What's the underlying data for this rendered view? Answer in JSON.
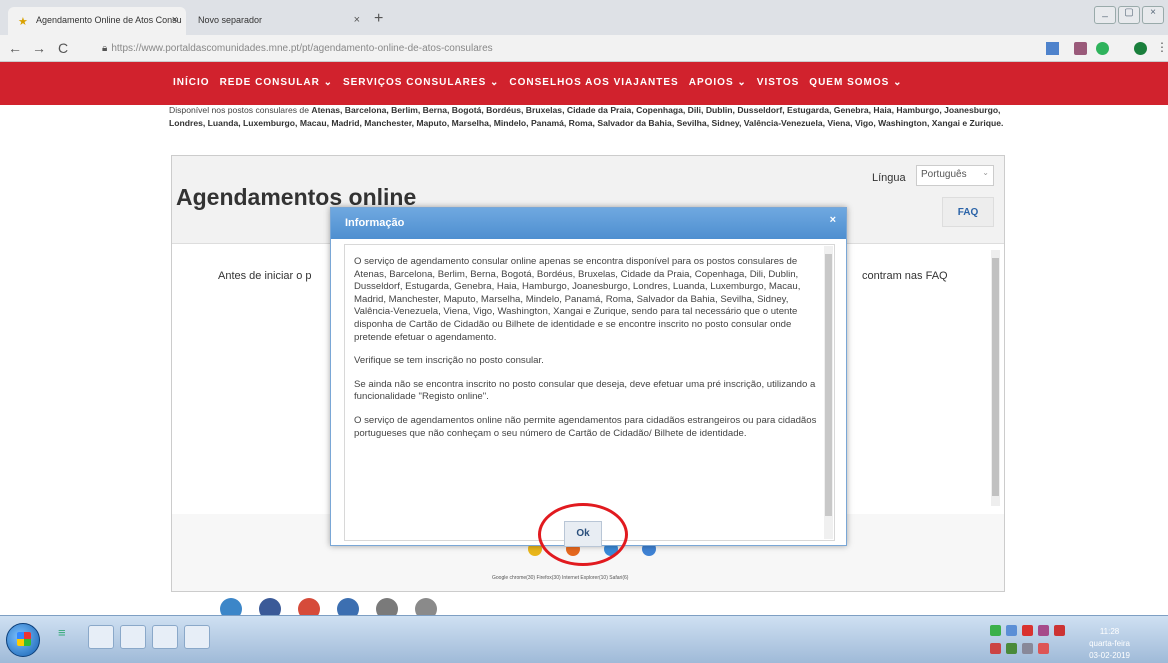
{
  "browser": {
    "tabs": [
      {
        "label": "Agendamento Online de Atos Consu",
        "close": "×"
      },
      {
        "label": "Novo separador",
        "close": "×"
      }
    ],
    "new_tab": "+",
    "nav": {
      "back": "←",
      "forward": "→",
      "reload": "C"
    },
    "url": "https://www.portaldascomunidades.mne.pt/pt/agendamento-online-de-atos-consulares",
    "window_buttons": [
      "_",
      "▢",
      "×"
    ]
  },
  "site_nav": {
    "items": [
      "INÍCIO",
      "REDE CONSULAR ⌄",
      "SERVIÇOS CONSULARES ⌄",
      "CONSELHOS AOS VIAJANTES",
      "APOIOS ⌄",
      "VISTOS",
      "QUEM SOMOS ⌄"
    ]
  },
  "intro": {
    "prefix": "Disponível nos postos consulares de ",
    "locations": "Atenas, Barcelona, Berlim, Berna, Bogotá, Bordéus, Bruxelas, Cidade da Praia, Copenhaga, Dili, Dublin, Dusseldorf, Estugarda, Genebra, Haia, Hamburgo, Joanesburgo, Londres, Luanda, Luxemburgo, Macau, Madrid, Manchester, Maputo, Marselha, Mindelo, Panamá, Roma, Salvador da Bahia, Sevilha, Sidney, Valência-Venezuela, Viena, Vigo, Washington, Xangai e Zurique."
  },
  "panel": {
    "title": "Agendamentos online",
    "language_label": "Língua",
    "language_value": "Português",
    "faq_label": "FAQ",
    "body_left": "Antes de iniciar o p",
    "body_right": "contram nas FAQ",
    "browsers_caption": "Google chrome(30) Firefox(30) Internet Explorer(10) Safari(6)"
  },
  "modal": {
    "title": "Informação",
    "close": "×",
    "paragraphs": [
      "O serviço de agendamento consular online apenas se encontra disponível para os postos consulares de Atenas, Barcelona, Berlim, Berna, Bogotá, Bordéus, Bruxelas, Cidade da Praia, Copenhaga, Dili, Dublin, Dusseldorf, Estugarda, Genebra, Haia, Hamburgo, Joanesburgo, Londres, Luanda, Luxemburgo, Macau, Madrid, Manchester, Maputo, Marselha, Mindelo, Panamá, Roma, Salvador da Bahia, Sevilha, Sidney, Valência-Venezuela, Viena, Vigo, Washington, Xangai e Zurique, sendo para tal necessário que o utente disponha de Cartão de Cidadão ou Bilhete de identidade e se encontre inscrito no posto consular onde pretende efetuar o agendamento.",
      "Verifique se tem inscrição no posto consular.",
      "Se ainda não se encontra inscrito no posto consular que deseja, deve efetuar uma pré inscrição, utilizando a funcionalidade \"Registo online\".",
      "O serviço de agendamentos online não permite agendamentos para cidadãos estrangeiros ou para cidadãos portugueses que não conheçam o seu número de Cartão de Cidadão/ Bilhete de identidade."
    ],
    "ok_label": "Ok"
  },
  "taskbar": {
    "clock_time": "11:28",
    "clock_day": "quarta-feira",
    "clock_date": "03-02-2019"
  },
  "colors": {
    "site_red": "#d1222d",
    "modal_header": "#5a9ad8",
    "highlight": "#e11a1f"
  }
}
